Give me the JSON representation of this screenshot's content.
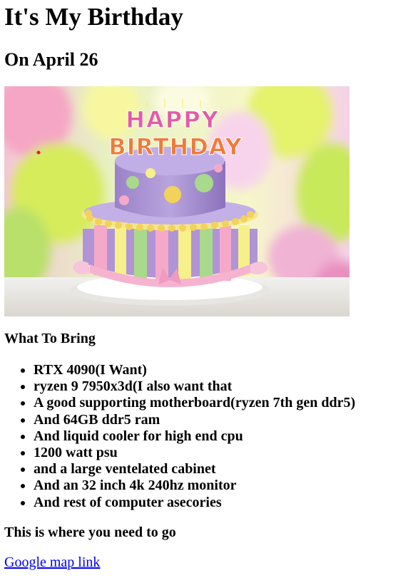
{
  "header": {
    "title": "It's My Birthday",
    "subtitle": "On April 26"
  },
  "hero_image": {
    "cake_text_top": "HAPPY",
    "cake_text_bottom": "BIRTHDAY"
  },
  "bring": {
    "heading": "What To Bring",
    "items": [
      "RTX 4090(I Want)",
      "ryzen 9 7950x3d(I also want that",
      "A good supporting motherboard(ryzen 7th gen ddr5)",
      "And 64GB ddr5 ram",
      "And liquid cooler for high end cpu",
      "1200 watt psu",
      "and a large ventelated cabinet",
      "And an 32 inch 4k 240hz monitor",
      "And rest of computer asecories"
    ]
  },
  "location": {
    "heading": "This is where you need to go",
    "link_text": "Google map link"
  },
  "colors": {
    "link": "#0000ee",
    "text": "#000000",
    "background": "#ffffff"
  }
}
